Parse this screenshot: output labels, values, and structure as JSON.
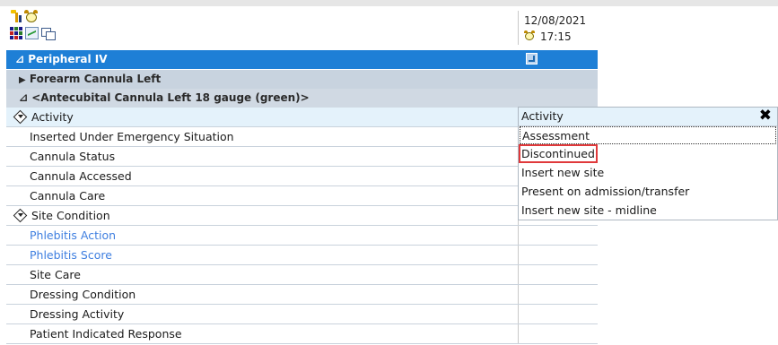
{
  "header": {
    "date": "12/08/2021",
    "time": "17:15"
  },
  "toolbar": {
    "icons": [
      "bar-chart-icon",
      "alarm-clock-icon",
      "grid-icon",
      "line-chart-icon",
      "windows-icon"
    ]
  },
  "section": {
    "toggle": "⊿",
    "title": "Peripheral IV"
  },
  "group": {
    "arrow": "▶",
    "title": "Forearm Cannula Left"
  },
  "subgroup": {
    "toggle": "⊿",
    "title": "<Antecubital Cannula Left 18 gauge (green)>"
  },
  "rows": [
    "Activity",
    "Inserted Under Emergency Situation",
    "Cannula Status",
    "Cannula Accessed",
    "Cannula Care",
    "Site Condition",
    "Phlebitis Action",
    "Phlebitis Score",
    "Site Care",
    "Dressing Condition",
    "Dressing Activity",
    "Patient Indicated Response"
  ],
  "dropdown": {
    "title": "Activity",
    "close": "✖",
    "options": [
      "Assessment",
      "Discontinued",
      "Insert new site",
      "Present on admission/transfer",
      "Insert new site - midline"
    ]
  },
  "colors": {
    "section_bg": "#1e7fd6",
    "group_bg": "#c8d3df",
    "link_blue": "#3f7fe0",
    "highlight_red": "#e0393b"
  }
}
